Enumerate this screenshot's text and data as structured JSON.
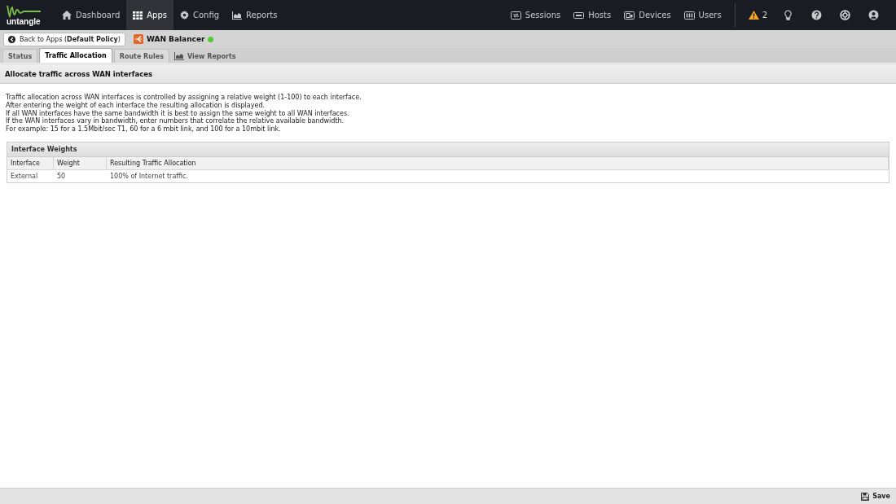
{
  "logo": {
    "text": "untangle"
  },
  "nav": {
    "left": [
      {
        "label": "Dashboard",
        "selected": false
      },
      {
        "label": "Apps",
        "selected": true
      },
      {
        "label": "Config",
        "selected": false
      },
      {
        "label": "Reports",
        "selected": false
      }
    ],
    "right": [
      {
        "label": "Sessions"
      },
      {
        "label": "Hosts"
      },
      {
        "label": "Devices"
      },
      {
        "label": "Users"
      }
    ],
    "alerts": {
      "count": "2"
    }
  },
  "app_bar": {
    "back_button": "Back to Apps (**Default Policy**)",
    "app_name": "WAN Balancer",
    "running": true
  },
  "tabs": [
    {
      "label": "Status",
      "selected": false,
      "kind": "tab"
    },
    {
      "label": "Traffic Allocation",
      "selected": true,
      "kind": "tab"
    },
    {
      "label": "Route Rules",
      "selected": false,
      "kind": "tab"
    },
    {
      "label": "View Reports",
      "selected": false,
      "kind": "link"
    }
  ],
  "panel": {
    "title": "Allocate traffic across WAN interfaces",
    "description": [
      "Traffic allocation across WAN interfaces is controlled by assigning a relative weight (1-100) to each interface.",
      "After entering the weight of each interface the resulting allocation is displayed.",
      "If all WAN interfaces have the same bandwidth it is best to assign the same weight to all WAN interfaces.",
      "If the WAN interfaces vary in bandwidth, enter numbers that correlate the relative available bandwidth.",
      "For example: 15 for a 1.5Mbit/sec T1, 60 for a 6 mbit link, and 100 for a 10mbit link."
    ],
    "grid": {
      "title": "Interface Weights",
      "columns": [
        "Interface",
        "Weight",
        "Resulting Traffic Allocation"
      ],
      "rows": [
        [
          "External",
          "50",
          "100% of Internet traffic."
        ]
      ]
    }
  },
  "footer": {
    "save_button": "Save"
  }
}
